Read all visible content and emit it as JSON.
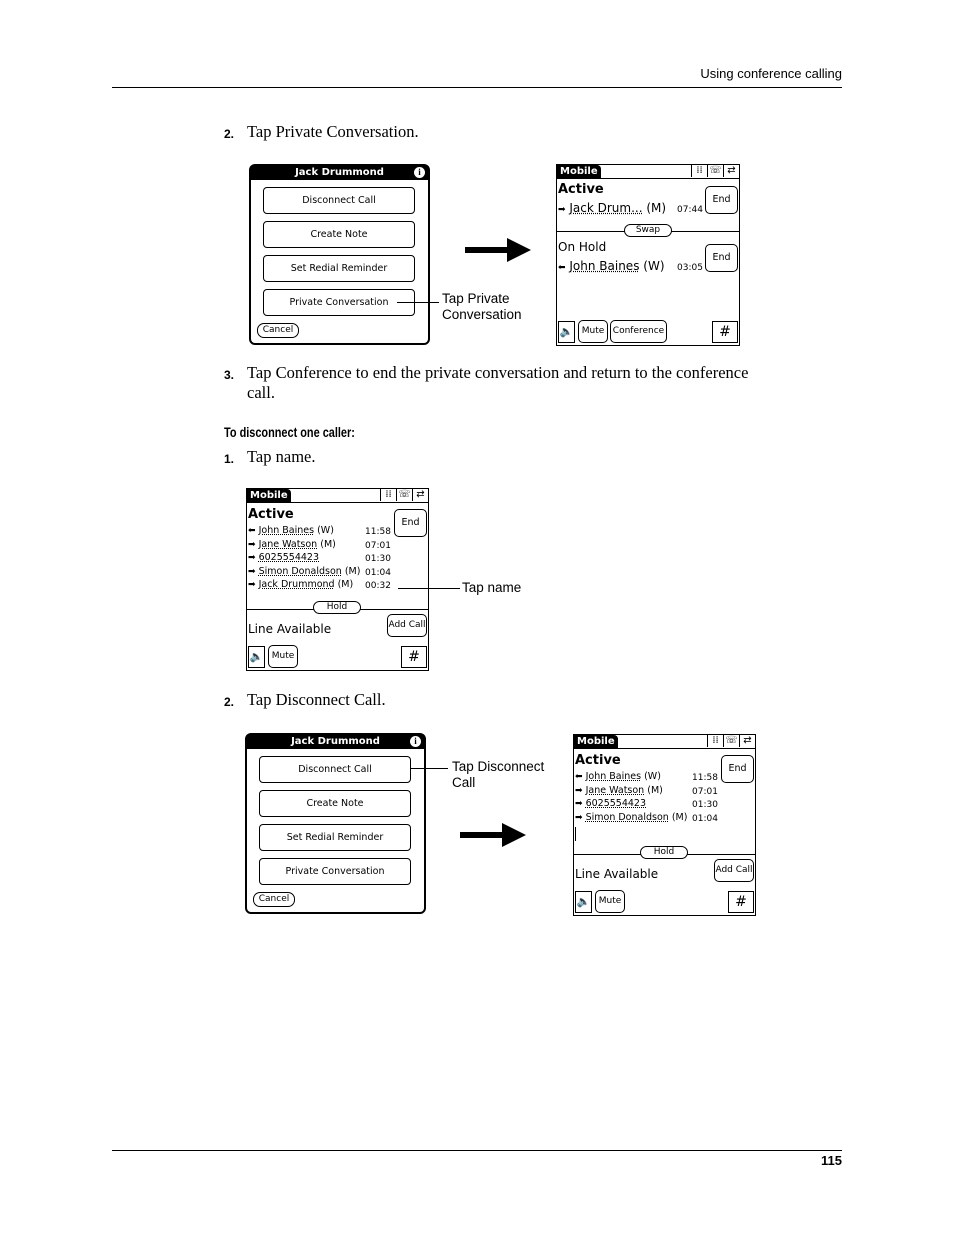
{
  "header": {
    "section_title": "Using conference calling"
  },
  "steps_a": [
    {
      "num": "2.",
      "text": "Tap Private Conversation."
    },
    {
      "num": "3.",
      "text": "Tap Conference to end the private conversation and return to the conference",
      "text2": "call."
    }
  ],
  "subheading": "To disconnect one caller:",
  "steps_b": [
    {
      "num": "1.",
      "text": "Tap name."
    },
    {
      "num": "2.",
      "text": "Tap Disconnect Call."
    }
  ],
  "callouts": {
    "private_line1": "Tap Private",
    "private_line2": "Conversation",
    "tap_name": "Tap name",
    "disconnect_line1": "Tap Disconnect",
    "disconnect_line2": "Call"
  },
  "dialog": {
    "title": "Jack Drummond",
    "info_icon": "i",
    "buttons": [
      "Disconnect Call",
      "Create Note",
      "Set Redial Reminder",
      "Private Conversation"
    ],
    "cancel": "Cancel"
  },
  "screen_private": {
    "tab": "Mobile",
    "icons": [
      "keypad-icon",
      "phone-icon",
      "transfer-icon"
    ],
    "icon_glyphs": [
      "⁞⁞",
      "☏",
      "⇄"
    ],
    "active_label": "Active",
    "active_caller": {
      "arrow": "➡",
      "name": "Jack Drum...",
      "type": "(M)",
      "time": "07:44"
    },
    "end": "End",
    "swap": "Swap",
    "hold_label": "On Hold",
    "hold_caller": {
      "arrow": "⬅",
      "name": "John Baines",
      "type": "(W)",
      "time": "03:05"
    },
    "speaker": "🔈",
    "mute": "Mute",
    "conference": "Conference",
    "hash": "#"
  },
  "screen_conf": {
    "tab": "Mobile",
    "icon_glyphs": [
      "⁞⁞",
      "☏",
      "⇄"
    ],
    "active_label": "Active",
    "end": "End",
    "callers": [
      {
        "arrow": "⬅",
        "name": "John Baines",
        "type": "(W)",
        "time": "11:58"
      },
      {
        "arrow": "➡",
        "name": "Jane Watson",
        "type": "(M)",
        "time": "07:01"
      },
      {
        "arrow": "➡",
        "name": "6025554423",
        "type": "",
        "time": "01:30"
      },
      {
        "arrow": "➡",
        "name": "Simon Donaldson",
        "type": "(M)",
        "time": "01:04"
      },
      {
        "arrow": "➡",
        "name": "Jack Drummond",
        "type": "(M)",
        "time": "00:32"
      }
    ],
    "hold": "Hold",
    "line_available": "Line Available",
    "add_call": "Add Call",
    "speaker": "🔈",
    "mute": "Mute",
    "hash": "#"
  },
  "screen_after": {
    "tab": "Mobile",
    "icon_glyphs": [
      "⁞⁞",
      "☏",
      "⇄"
    ],
    "active_label": "Active",
    "end": "End",
    "callers": [
      {
        "arrow": "⬅",
        "name": "John Baines",
        "type": "(W)",
        "time": "11:58"
      },
      {
        "arrow": "➡",
        "name": "Jane Watson",
        "type": "(M)",
        "time": "07:01"
      },
      {
        "arrow": "➡",
        "name": "6025554423",
        "type": "",
        "time": "01:30"
      },
      {
        "arrow": "➡",
        "name": "Simon Donaldson",
        "type": "(M)",
        "time": "01:04"
      }
    ],
    "hold": "Hold",
    "line_available": "Line Available",
    "add_call": "Add Call",
    "speaker": "🔈",
    "mute": "Mute",
    "hash": "#"
  },
  "footer": {
    "page_number": "115"
  }
}
